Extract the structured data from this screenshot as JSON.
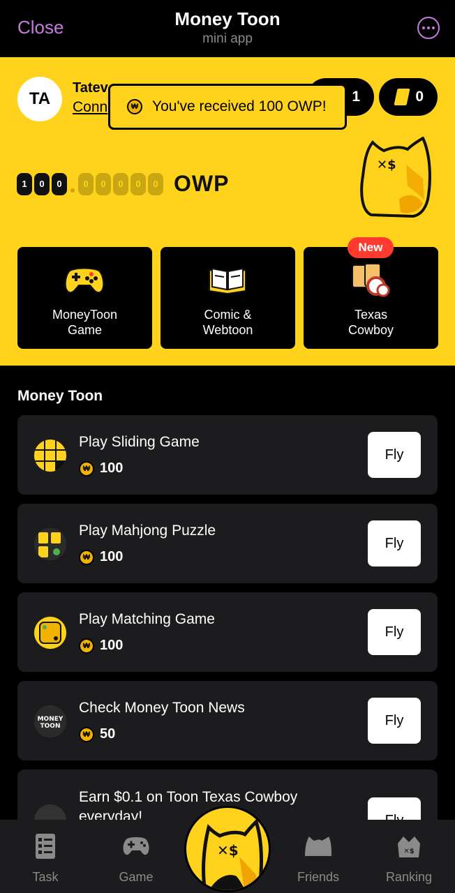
{
  "header": {
    "close_label": "Close",
    "title": "Money Toon",
    "subtitle": "mini app"
  },
  "user": {
    "initials": "TA",
    "name": "Tatev",
    "link_text": "Conn"
  },
  "counters": {
    "first": "1",
    "second": "0"
  },
  "toast": {
    "text": "You've received 100 OWP!"
  },
  "balance": {
    "int_digits": [
      "1",
      "0",
      "0"
    ],
    "dec_digits": [
      "0",
      "0",
      "0",
      "0",
      "0"
    ],
    "unit": "OWP"
  },
  "cards": [
    {
      "label_line1": "MoneyToon",
      "label_line2": "Game",
      "icon": "gamepad-icon"
    },
    {
      "label_line1": "Comic &",
      "label_line2": "Webtoon",
      "icon": "book-icon"
    },
    {
      "label_line1": "Texas",
      "label_line2": "Cowboy",
      "icon": "cards-chips-icon",
      "badge": "New"
    }
  ],
  "section_title": "Money Toon",
  "tasks": [
    {
      "title": "Play Sliding Game",
      "reward": "100",
      "button": "Fly",
      "icon": "sliding-game-icon"
    },
    {
      "title": "Play Mahjong Puzzle",
      "reward": "100",
      "button": "Fly",
      "icon": "mahjong-icon"
    },
    {
      "title": "Play Matching Game",
      "reward": "100",
      "button": "Fly",
      "icon": "matching-game-icon"
    },
    {
      "title": "Check Money Toon News",
      "reward": "50",
      "button": "Fly",
      "icon": "news-icon"
    },
    {
      "title_line1": "Earn $0.1 on Toon Texas Cowboy",
      "title_line2": "everyday!",
      "button": "Fly",
      "icon": "cowboy-icon"
    }
  ],
  "nav": {
    "task": "Task",
    "game": "Game",
    "friends": "Friends",
    "ranking": "Ranking"
  },
  "colors": {
    "brand_yellow": "#ffd21c",
    "accent_purple": "#c77be0",
    "badge_red": "#ff3b30"
  }
}
